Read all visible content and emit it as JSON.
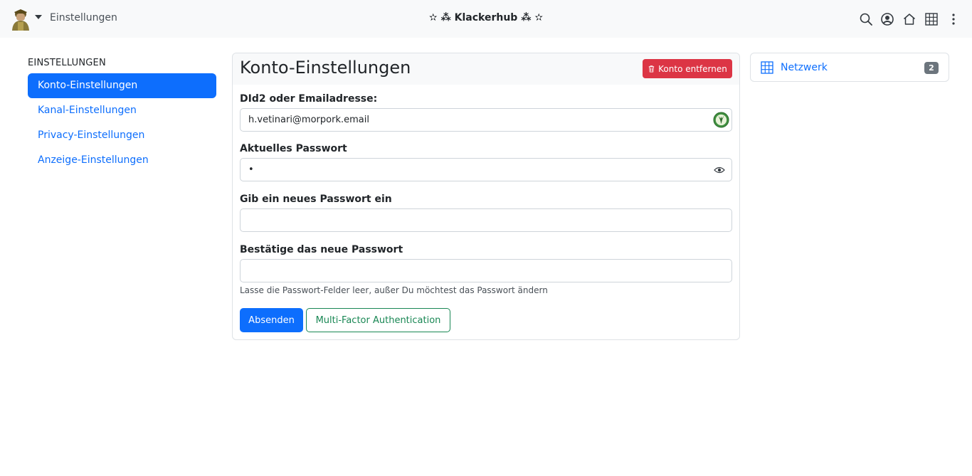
{
  "navbar": {
    "page_label": "Einstellungen",
    "site_title": "✫ ⁂ Klackerhub ⁂ ✫",
    "icons": [
      "search-icon",
      "user-circle-icon",
      "home-icon",
      "apps-grid-icon",
      "more-vertical-icon"
    ]
  },
  "sidebar": {
    "heading": "Einstellungen",
    "items": [
      {
        "label": "Konto-Einstellungen",
        "active": true
      },
      {
        "label": "Kanal-Einstellungen",
        "active": false
      },
      {
        "label": "Privacy-Einstellungen",
        "active": false
      },
      {
        "label": "Anzeige-Einstellungen",
        "active": false
      }
    ]
  },
  "main": {
    "title": "Konto-Einstellungen",
    "remove_button": "Konto entfernen",
    "fields": {
      "email": {
        "label": "DId2 oder Emailadresse:",
        "value": "h.vetinari@morpork.email"
      },
      "current_password": {
        "label": "Aktuelles Passwort",
        "value": "•"
      },
      "new_password": {
        "label": "Gib ein neues Passwort ein",
        "value": ""
      },
      "confirm_password": {
        "label": "Bestätige das neue Passwort",
        "value": ""
      }
    },
    "hint": "Lasse die Passwort-Felder leer, außer Du möchtest das Passwort ändern",
    "submit_button": "Absenden",
    "mfa_button": "Multi-Factor Authentication"
  },
  "widget": {
    "label": "Netzwerk",
    "count": "2"
  },
  "colors": {
    "primary": "#0d6efd",
    "danger": "#dc3545",
    "success": "#198754",
    "secondary": "#6c757d",
    "navbar_bg": "#f8f9fa"
  }
}
